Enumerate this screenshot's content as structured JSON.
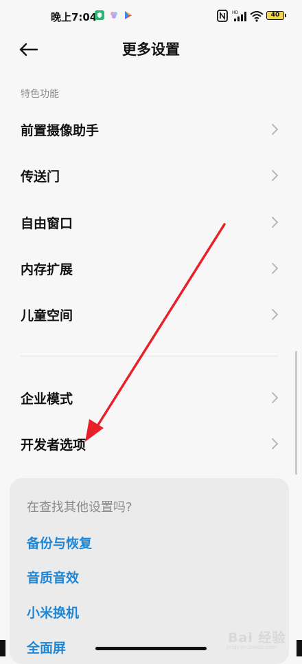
{
  "status_bar": {
    "time": "晚上7:04",
    "battery": "40",
    "network_label": "HD"
  },
  "header": {
    "title": "更多设置"
  },
  "sections": {
    "featured_label": "特色功能",
    "featured_items": [
      {
        "label": "前置摄像助手"
      },
      {
        "label": "传送门"
      },
      {
        "label": "自由窗口"
      },
      {
        "label": "内存扩展"
      },
      {
        "label": "儿童空间"
      }
    ],
    "other_items": [
      {
        "label": "企业模式"
      },
      {
        "label": "开发者选项"
      }
    ]
  },
  "suggestions": {
    "title": "在查找其他设置吗?",
    "links": [
      {
        "label": "备份与恢复"
      },
      {
        "label": "音质音效"
      },
      {
        "label": "小米换机"
      },
      {
        "label": "全面屏"
      }
    ]
  },
  "watermark": {
    "text": "Bai 经验",
    "subtext": "jingyan.baidu.com"
  },
  "colors": {
    "background": "#f7f7f7",
    "link": "#1f86d6",
    "annotation_arrow": "#e8202a"
  }
}
